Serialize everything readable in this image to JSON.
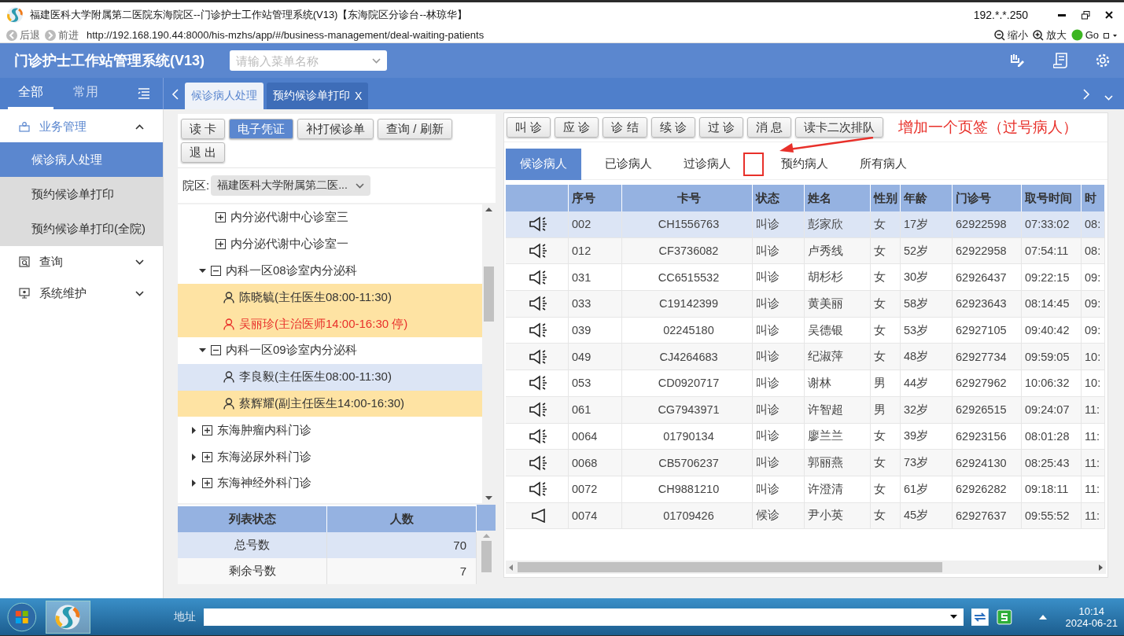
{
  "window": {
    "title": "福建医科大学附属第二医院东海院区--门诊护士工作站管理系统(V13)【东海院区分诊台--林琼华】",
    "ip": "192.*.*.250"
  },
  "browser": {
    "back": "后退",
    "forward": "前进",
    "url": "http://192.168.190.44:8000/his-mzhs/app/#/business-management/deal-waiting-patients",
    "zoom_out": "缩小",
    "zoom_in": "放大",
    "go": "Go"
  },
  "app": {
    "title": "门诊护士工作站管理系统(V13)",
    "menu_search": {
      "placeholder": "请输入菜单名称"
    }
  },
  "sidebar": {
    "tabs": [
      {
        "label": "全部",
        "selected": true
      },
      {
        "label": "常用",
        "selected": false
      }
    ],
    "items": [
      {
        "kind": "business",
        "label": "业务管理",
        "expanded": true,
        "children": [
          {
            "label": "候诊病人处理",
            "selected": true
          },
          {
            "label": "预约候诊单打印",
            "selected": false
          },
          {
            "label": "预约候诊单打印(全院)",
            "selected": false
          }
        ]
      },
      {
        "kind": "query",
        "label": "查询",
        "expanded": false
      },
      {
        "kind": "system",
        "label": "系统维护",
        "expanded": false
      }
    ]
  },
  "page_tabs": [
    {
      "label": "候诊病人处理",
      "selected": true
    },
    {
      "label": "预约候诊单打印",
      "selected": false,
      "close": "X"
    }
  ],
  "left_panel": {
    "buttons": [
      {
        "label": "读 卡",
        "selected": false
      },
      {
        "label": "电子凭证",
        "selected": true
      },
      {
        "label": "补打候诊单",
        "selected": false
      },
      {
        "label": "查询 / 刷新",
        "selected": false
      },
      {
        "label": "退 出",
        "selected": false
      }
    ],
    "campus": {
      "label": "院区:",
      "value": "福建医科大学附属第二医..."
    },
    "tree": [
      {
        "kind": "room",
        "label": "内分泌代谢中心诊室三"
      },
      {
        "kind": "room",
        "label": "内分泌代谢中心诊室一"
      },
      {
        "kind": "room-group",
        "label": "内科一区08诊室内分泌科",
        "expanded": true,
        "children": [
          {
            "label": "陈晓毓(主任医生08:00-11:30)",
            "selected": false,
            "stopped": false
          },
          {
            "label": "吴丽珍(主治医师14:00-16:30 停)",
            "selected": false,
            "stopped": true
          }
        ]
      },
      {
        "kind": "room-group",
        "label": "内科一区09诊室内分泌科",
        "expanded": true,
        "children": [
          {
            "label": "李良毅(主任医生08:00-11:30)",
            "selected": true,
            "stopped": false
          },
          {
            "label": "蔡辉耀(副主任医生14:00-16:30)",
            "selected": false,
            "stopped": false
          }
        ]
      },
      {
        "kind": "department",
        "label": "东海肿瘤内科门诊",
        "expanded": false
      },
      {
        "kind": "department",
        "label": "东海泌尿外科门诊",
        "expanded": false
      },
      {
        "kind": "department",
        "label": "东海神经外科门诊",
        "expanded": false
      }
    ],
    "summary": {
      "columns": [
        "列表状态",
        "人数"
      ],
      "rows": [
        {
          "label": "总号数",
          "count": "70",
          "selected": true
        },
        {
          "label": "剩余号数",
          "count": "7",
          "selected": false
        }
      ]
    }
  },
  "right_panel": {
    "buttons": [
      "叫 诊",
      "应 诊",
      "诊 结",
      "续 诊",
      "过 诊",
      "消 息",
      "读卡二次排队"
    ],
    "annotation": {
      "text": "增加一个页签（过号病人）"
    },
    "tabs": [
      {
        "label": "候诊病人",
        "selected": true
      },
      {
        "label": "已诊病人",
        "selected": false
      },
      {
        "label": "过诊病人",
        "selected": false
      },
      {
        "label": "预约病人",
        "selected": false
      },
      {
        "label": "所有病人",
        "selected": false
      }
    ],
    "table": {
      "columns": [
        "序号",
        "卡号",
        "状态",
        "姓名",
        "性别",
        "年龄",
        "门诊号",
        "取号时间",
        "时"
      ],
      "rows": [
        {
          "kind": "called",
          "selected": true,
          "cells": [
            "002",
            "CH1556763",
            "叫诊",
            "彭家欣",
            "女",
            "17岁",
            "62922598",
            "07:33:02",
            "08:"
          ]
        },
        {
          "kind": "called",
          "selected": false,
          "cells": [
            "012",
            "CF3736082",
            "叫诊",
            "卢秀线",
            "女",
            "52岁",
            "62922958",
            "07:54:11",
            "08:"
          ]
        },
        {
          "kind": "called",
          "selected": false,
          "cells": [
            "031",
            "CC6515532",
            "叫诊",
            "胡杉杉",
            "女",
            "30岁",
            "62926437",
            "09:22:15",
            "09:"
          ]
        },
        {
          "kind": "called",
          "selected": false,
          "cells": [
            "033",
            "C19142399",
            "叫诊",
            "黄美丽",
            "女",
            "58岁",
            "62923643",
            "08:14:45",
            "09:"
          ]
        },
        {
          "kind": "called",
          "selected": false,
          "cells": [
            "039",
            "02245180",
            "叫诊",
            "吴德银",
            "女",
            "53岁",
            "62927105",
            "09:40:42",
            "09:"
          ]
        },
        {
          "kind": "called",
          "selected": false,
          "cells": [
            "049",
            "CJ4264683",
            "叫诊",
            "纪淑萍",
            "女",
            "48岁",
            "62927734",
            "09:59:05",
            "10:"
          ]
        },
        {
          "kind": "called",
          "selected": false,
          "cells": [
            "053",
            "CD0920717",
            "叫诊",
            "谢林",
            "男",
            "44岁",
            "62927962",
            "10:06:32",
            "10:"
          ]
        },
        {
          "kind": "called",
          "selected": false,
          "cells": [
            "061",
            "CG7943971",
            "叫诊",
            "许智超",
            "男",
            "32岁",
            "62926515",
            "09:24:07",
            "11:"
          ]
        },
        {
          "kind": "called",
          "selected": false,
          "cells": [
            "0064",
            "01790134",
            "叫诊",
            "廖兰兰",
            "女",
            "39岁",
            "62923156",
            "08:01:28",
            "11:"
          ]
        },
        {
          "kind": "called",
          "selected": false,
          "cells": [
            "0068",
            "CB5706237",
            "叫诊",
            "郭丽燕",
            "女",
            "73岁",
            "62924130",
            "08:25:43",
            "11:"
          ]
        },
        {
          "kind": "called",
          "selected": false,
          "cells": [
            "0072",
            "CH9881210",
            "叫诊",
            "许澄清",
            "女",
            "61岁",
            "62926282",
            "09:18:11",
            "11:"
          ]
        },
        {
          "kind": "waiting",
          "selected": false,
          "cells": [
            "0074",
            "01709426",
            "候诊",
            "尹小英",
            "女",
            "45岁",
            "62927637",
            "09:55:52",
            "11:"
          ]
        }
      ]
    }
  },
  "taskbar": {
    "address_label": "地址",
    "time": "10:14",
    "date": "2024-06-21"
  }
}
